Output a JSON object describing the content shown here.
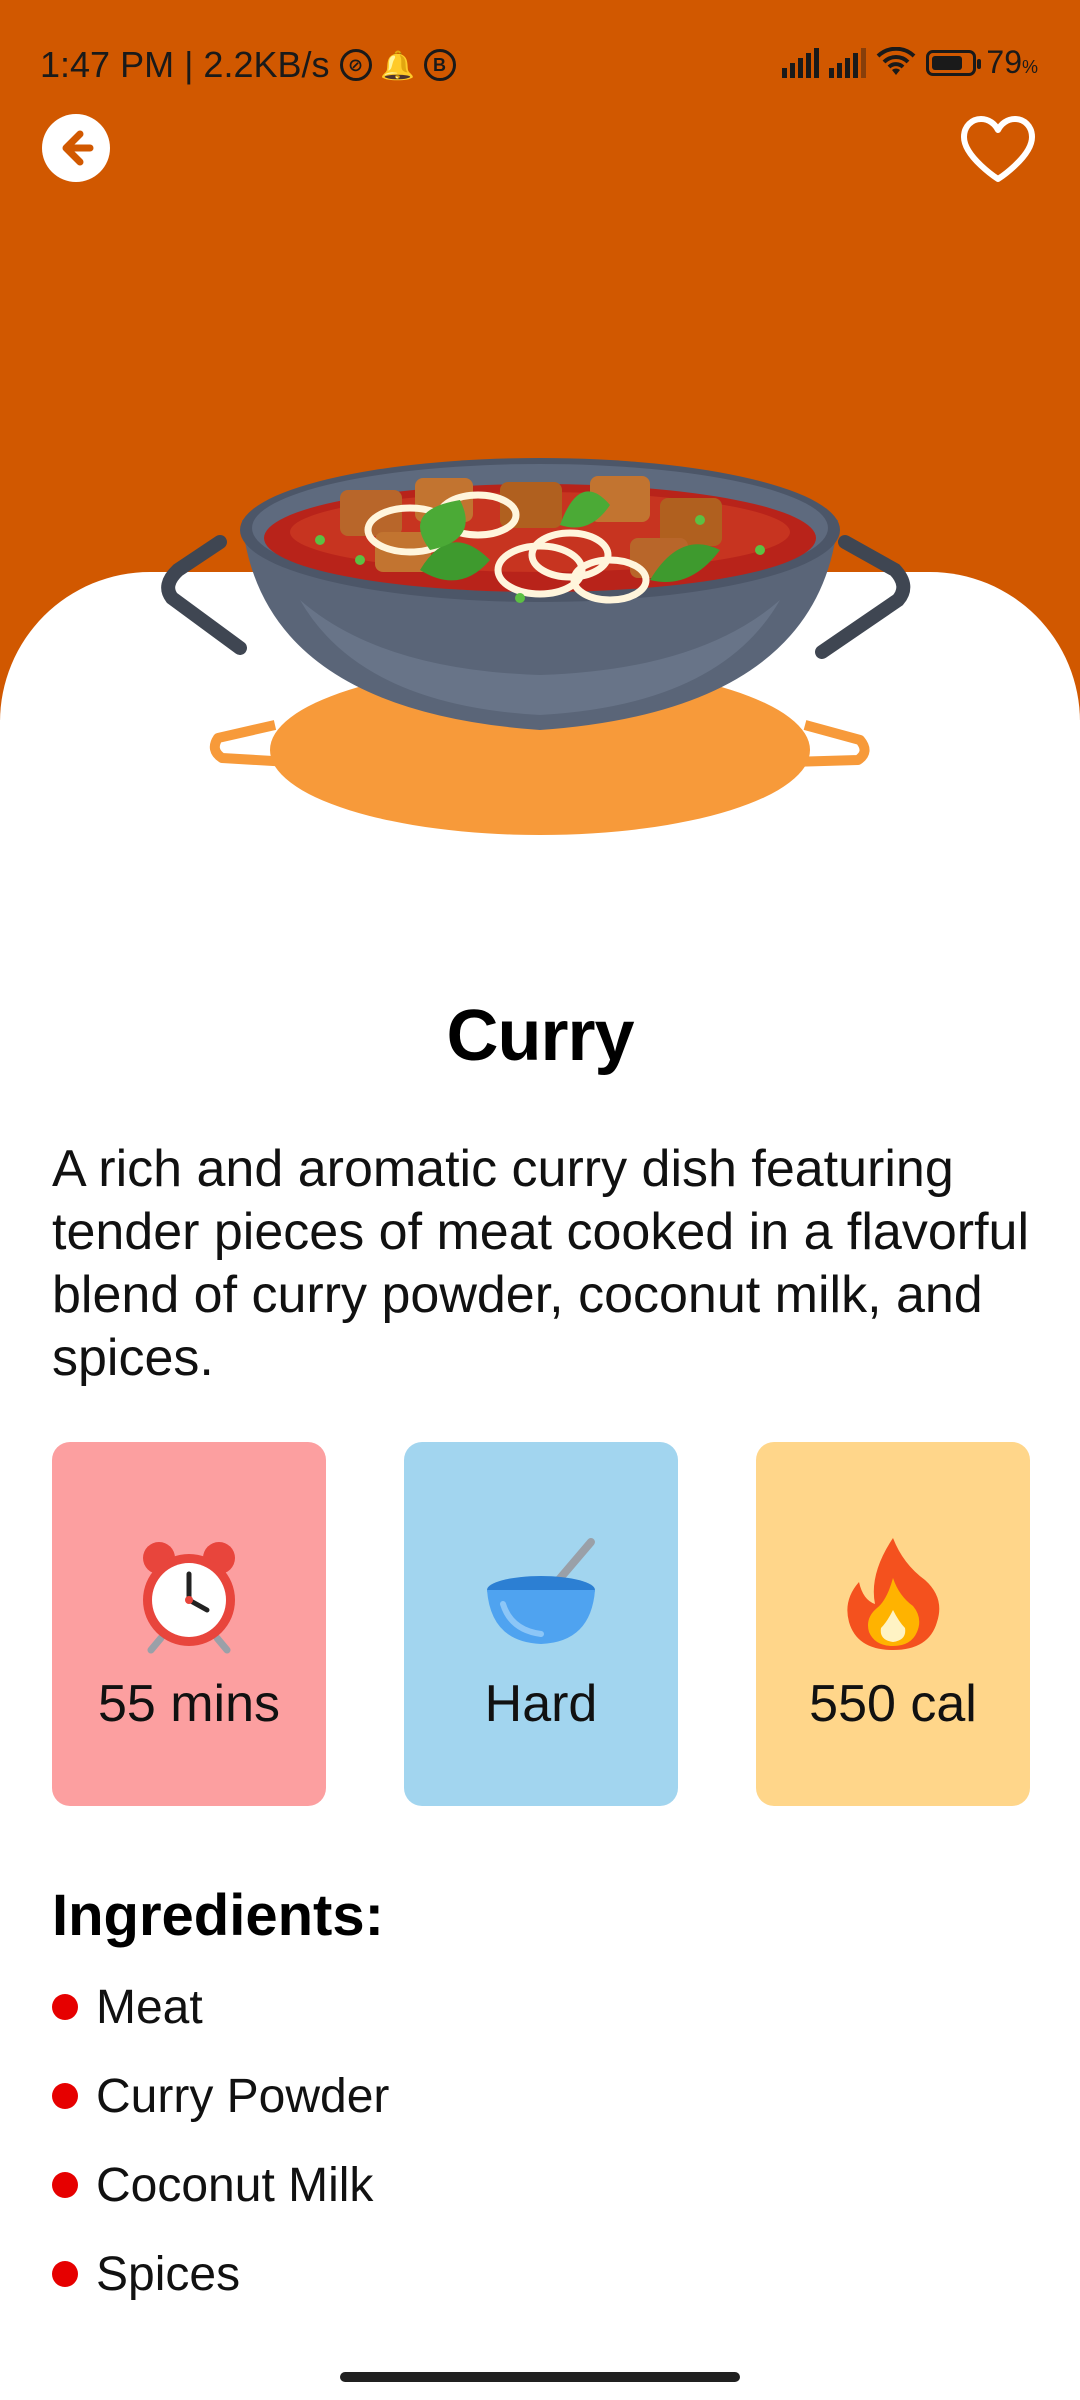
{
  "status_bar": {
    "time_speed": "1:47 PM | 2.2KB/s",
    "battery": "79",
    "battery_unit": "%"
  },
  "header": {
    "back_icon": "arrow-left-icon",
    "favorite_icon": "heart-outline-icon",
    "background_color": "#D15800"
  },
  "recipe": {
    "image": "curry-pot-illustration",
    "title": "Curry",
    "description": "A rich and aromatic curry dish featuring tender pieces of meat cooked in a flavorful blend of curry powder, coconut milk, and spices."
  },
  "info_cards": [
    {
      "icon": "alarm-clock-icon",
      "value": "55 mins",
      "color": "#FC9FA0"
    },
    {
      "icon": "bowl-spoon-icon",
      "value": "Hard",
      "color": "#A2D5EF"
    },
    {
      "icon": "fire-icon",
      "value": "550 cal",
      "color": "#FFD68A"
    }
  ],
  "ingredients": {
    "heading": "Ingredients:",
    "bullet_color": "#E60000",
    "items": [
      "Meat",
      "Curry Powder",
      "Coconut Milk",
      "Spices"
    ]
  }
}
